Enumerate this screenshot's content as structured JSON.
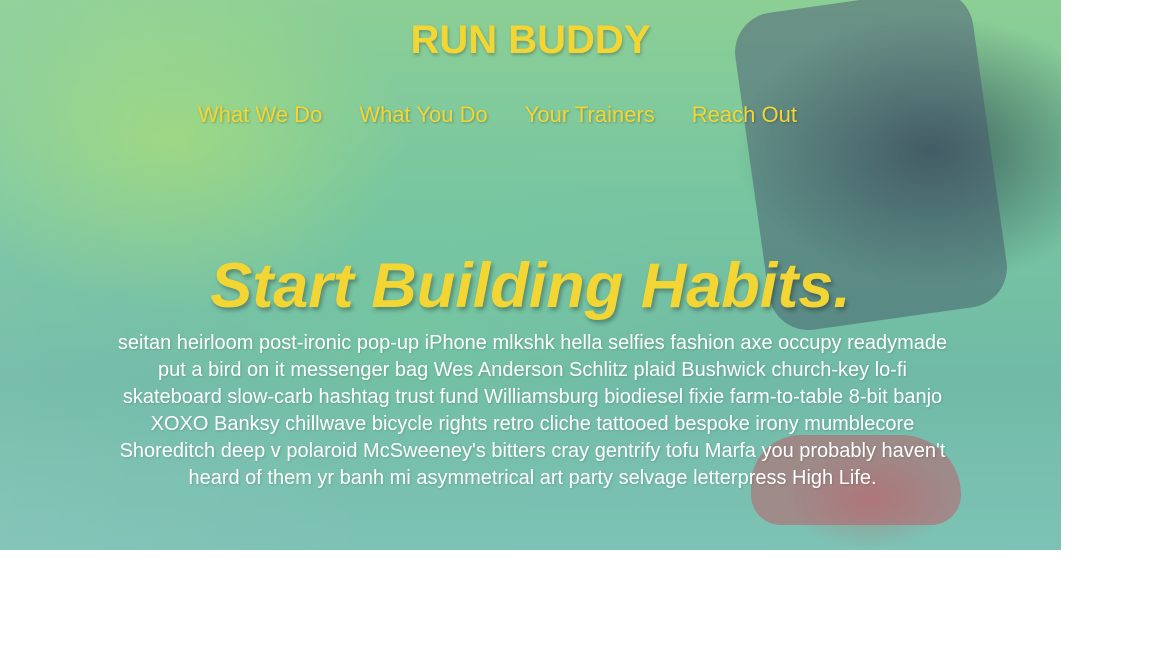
{
  "site": {
    "brand": "RUN BUDDY",
    "nav": [
      {
        "label": "What We Do"
      },
      {
        "label": "What You Do"
      },
      {
        "label": "Your Trainers"
      },
      {
        "label": "Reach Out"
      }
    ]
  },
  "hero": {
    "headline": "Start Building Habits.",
    "description": "seitan heirloom post-ironic pop-up iPhone mlkshk hella selfies fashion axe occupy readymade put a bird on it messenger bag Wes Anderson Schlitz plaid Bushwick church-key lo-fi skateboard slow-carb hashtag trust fund Williamsburg biodiesel fixie farm-to-table 8-bit banjo XOXO Banksy chillwave bicycle rights retro cliche tattooed bespoke irony mumblecore Shoreditch deep v polaroid McSweeney's bitters cray gentrify tofu Marfa you probably haven't heard of them yr banh mi asymmetrical art party selvage letterpress High Life.",
    "colors": {
      "accent": "#f3d634",
      "text": "#ffffff",
      "overlay": "#79c7a0"
    },
    "background_image": "runner-tying-shoe-photo"
  }
}
